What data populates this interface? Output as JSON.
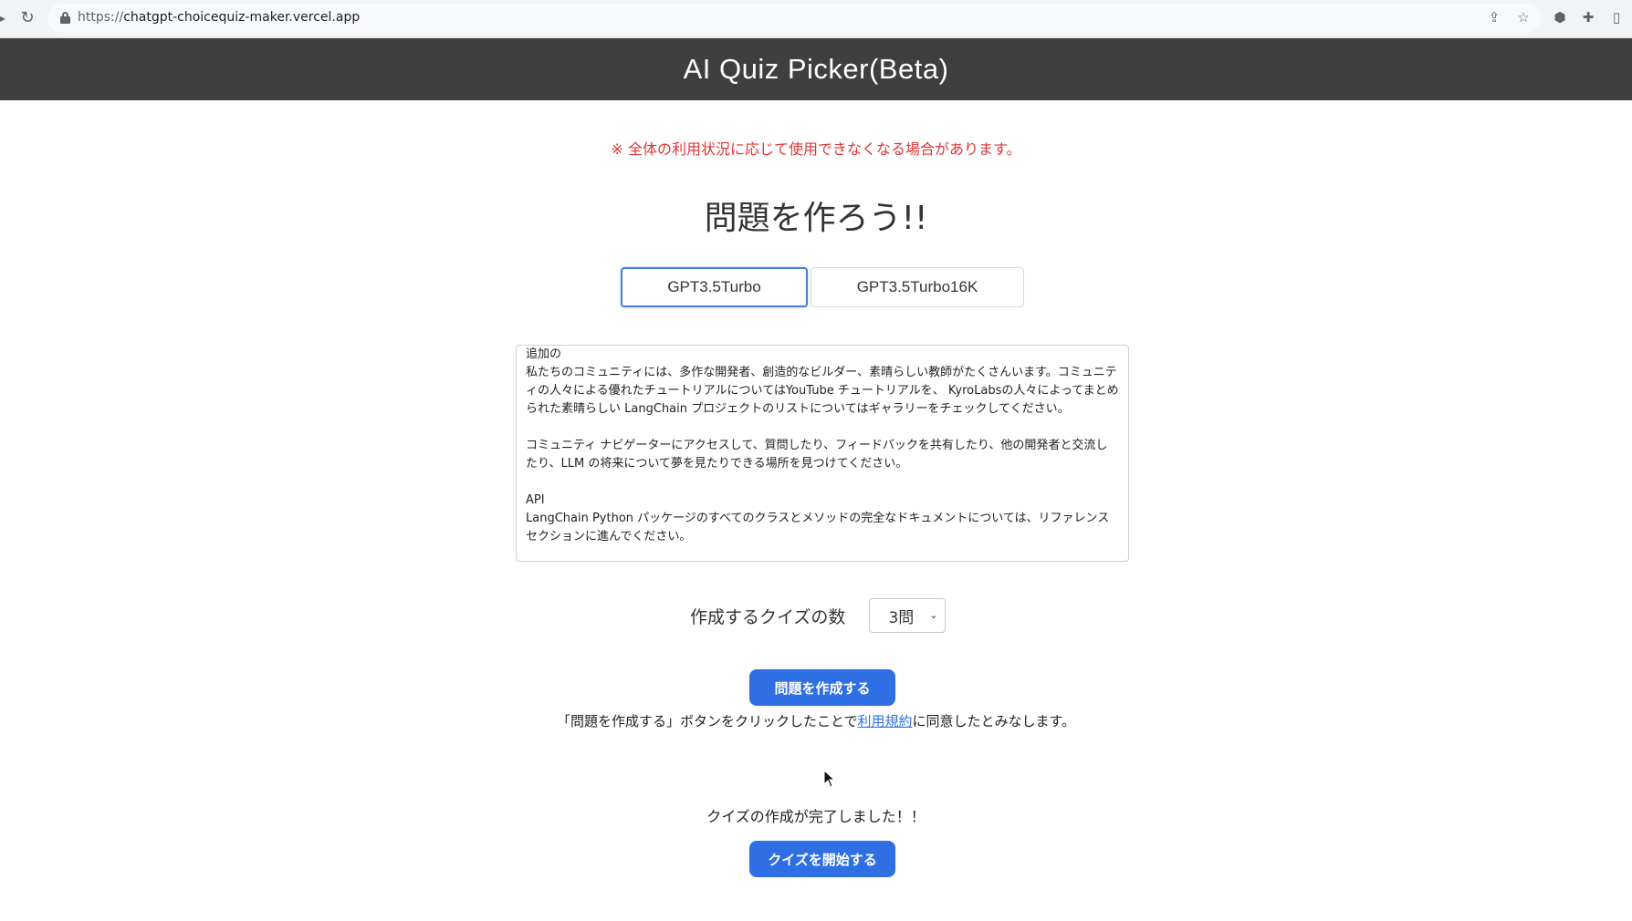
{
  "browser": {
    "url_scheme": "https://",
    "url_host": "chatgpt-choicequiz-maker.vercel.app"
  },
  "header": {
    "title": "AI Quiz Picker(Beta)"
  },
  "main": {
    "notice": "※ 全体の利用状況に応じて使用できなくなる場合があります。",
    "title": "問題を作ろう!!",
    "model_tabs": [
      {
        "label": "GPT3.5Turbo",
        "active": true
      },
      {
        "label": "GPT3.5Turbo16K",
        "active": false
      }
    ],
    "source_text": "追加の\n私たちのコミュニティには、多作な開発者、創造的なビルダー、素晴らしい教師がたくさんいます。コミュニティの人々による優れたチュートリアルについてはYouTube チュートリアルを、 KyroLabsの人々によってまとめられた素晴らしい LangChain プロジェクトのリストについてはギャラリーをチェックしてください。\n\nコミュニティ ナビゲーターにアクセスして、質問したり、フィードバックを共有したり、他の開発者と交流したり、LLM の将来について夢を見たりできる場所を見つけてください。\n\nAPI\nLangChain Python パッケージのすべてのクラスとメソッドの完全なドキュメントについては、リファレンスセクションに進んでください。",
    "quiz_count": {
      "label": "作成するクイズの数",
      "selected": "3問"
    },
    "create_button": "問題を作成する",
    "terms": {
      "prefix": "「問題を作成する」ボタンをクリックしたことで",
      "link": "利用規約",
      "suffix": "に同意したとみなします。"
    },
    "done_message": "クイズの作成が完了しました！！",
    "start_button": "クイズを開始する"
  },
  "colors": {
    "header_bg": "#3f3f3f",
    "primary": "#2f6fe4",
    "notice": "#e03434"
  }
}
